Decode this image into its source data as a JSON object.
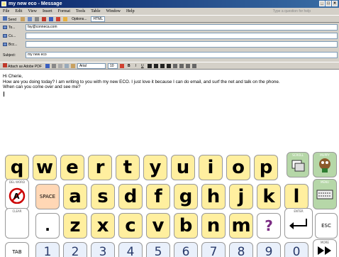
{
  "window": {
    "title": "my new eco - Message",
    "controls": [
      "_",
      "□",
      "×"
    ]
  },
  "menu": {
    "items": [
      "File",
      "Edit",
      "View",
      "Insert",
      "Format",
      "Tools",
      "Table",
      "Window",
      "Help"
    ],
    "help_placeholder": "Type a question for help"
  },
  "toolbar": {
    "send_label": "Send",
    "options_label": "Options...",
    "format_value": "HTML"
  },
  "header": {
    "to_label": "To...",
    "to_value": "fay@conneca.com",
    "cc_label": "Cc...",
    "cc_value": "",
    "bcc_label": "Bcc...",
    "bcc_value": "",
    "subject_label": "Subject:",
    "subject_value": "my new eco"
  },
  "format_bar": {
    "attach_label": "Attach as Adobe PDF",
    "font_value": "Arial",
    "size_value": "10"
  },
  "message": {
    "line1": "Hi Cherie,",
    "line2": "How are you doing today? I am writing to you with my new ECO. I just love it because I can do email, and surf the net and talk on the phone.",
    "line3": "When can you come over and see me?"
  },
  "keyboard": {
    "row1": [
      "q",
      "w",
      "e",
      "r",
      "t",
      "y",
      "u",
      "i",
      "o",
      "p"
    ],
    "scroll_label": "SCROLL",
    "muppy_label": "MUPPY",
    "del_word_label": "DEL WORD",
    "space_label": "SPACE",
    "row2": [
      "a",
      "s",
      "d",
      "f",
      "g",
      "h",
      "j",
      "k",
      "l"
    ],
    "menu_label": "MENU",
    "clear_label": "CLEAR",
    "period_label": ".",
    "row3": [
      "z",
      "x",
      "c",
      "v",
      "b",
      "n",
      "m"
    ],
    "question_label": "?",
    "enter_label": "ENTER",
    "esc_label": "ESC",
    "tab_label": "TAB",
    "row4": [
      "1",
      "2",
      "3",
      "4",
      "5",
      "6",
      "7",
      "8",
      "9",
      "0"
    ],
    "more_label": "MORE"
  }
}
